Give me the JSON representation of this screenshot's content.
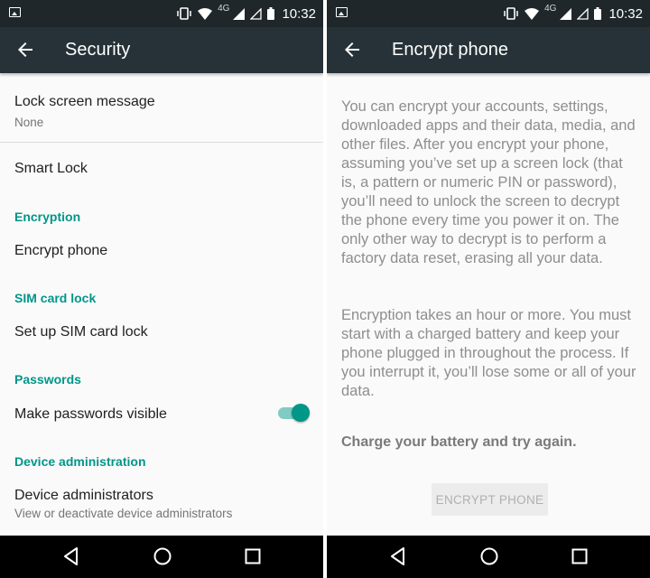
{
  "status_bar": {
    "time": "10:32",
    "network": "4G",
    "icons": [
      "notification-icon",
      "vibrate-icon",
      "wifi-icon",
      "signal-icon",
      "signal-empty-icon",
      "battery-icon"
    ]
  },
  "colors": {
    "accent": "#009688",
    "appbar": "#263238",
    "statusbar": "#1f272b"
  },
  "left_screen": {
    "title": "Security",
    "items": {
      "lock_screen_message": {
        "title": "Lock screen message",
        "subtitle": "None"
      },
      "smart_lock": {
        "title": "Smart Lock"
      },
      "encryption_header": "Encryption",
      "encrypt_phone": {
        "title": "Encrypt phone"
      },
      "sim_header": "SIM card lock",
      "sim_lock": {
        "title": "Set up SIM card lock"
      },
      "passwords_header": "Passwords",
      "passwords_visible": {
        "title": "Make passwords visible",
        "enabled": true
      },
      "device_admin_header": "Device administration",
      "device_admins": {
        "title": "Device administrators",
        "subtitle": "View or deactivate device administrators"
      }
    }
  },
  "right_screen": {
    "title": "Encrypt phone",
    "paragraph1": "You can encrypt your accounts, settings, downloaded apps and their data, media, and other files. After you encrypt your phone, assuming you’ve set up a screen lock (that is, a pattern or numeric PIN or password), you’ll need to unlock the screen to decrypt the phone every time you power it on. The only other way to decrypt is to perform a factory data reset, erasing all your data.",
    "paragraph2": "Encryption takes an hour or more. You must start with a charged battery and keep your phone plugged in throughout the process. If you interrupt it, you’ll lose some or all of your data.",
    "warning": "Charge your battery and try again.",
    "button_label": "ENCRYPT PHONE"
  }
}
